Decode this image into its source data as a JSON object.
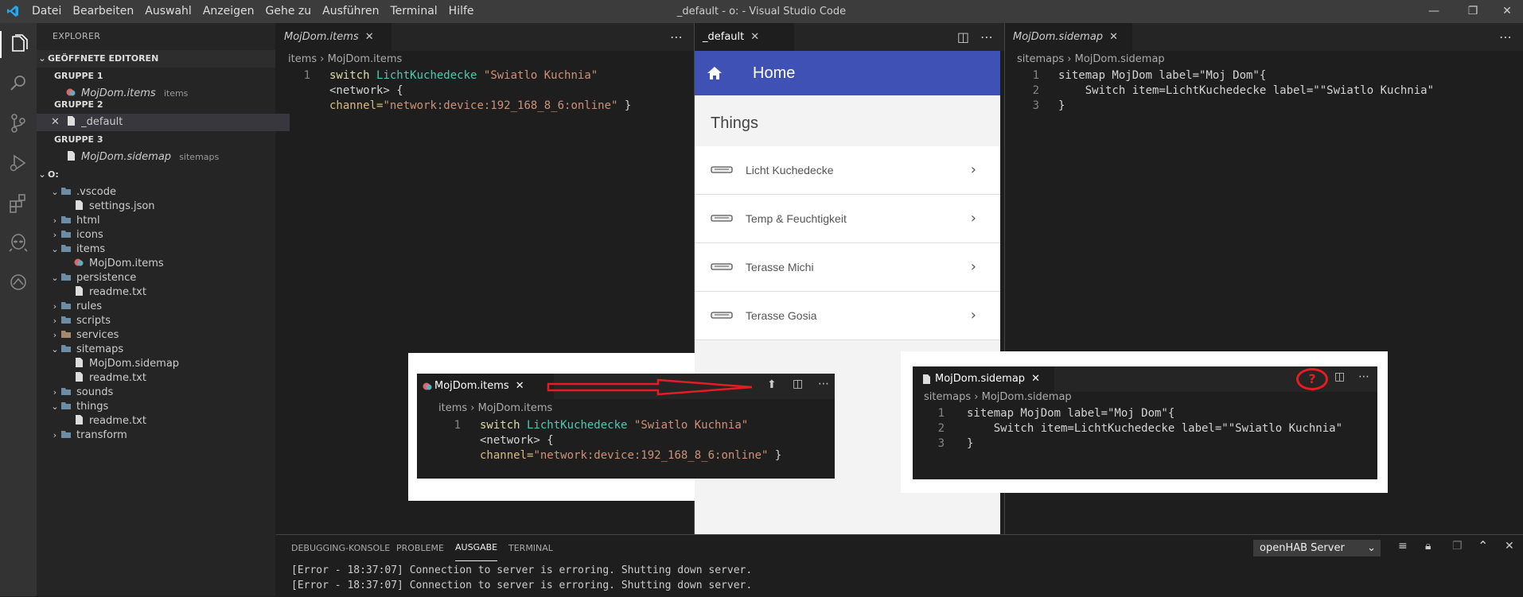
{
  "window": {
    "title": "_default - o: - Visual Studio Code",
    "menu": [
      "Datei",
      "Bearbeiten",
      "Auswahl",
      "Anzeigen",
      "Gehe zu",
      "Ausführen",
      "Terminal",
      "Hilfe"
    ]
  },
  "sidebar": {
    "header": "EXPLORER",
    "open_editors_label": "GEÖFFNETE EDITOREN",
    "groups": [
      {
        "label": "GRUPPE 1",
        "file": "MojDom.items",
        "desc": "items"
      },
      {
        "label": "GRUPPE 2",
        "file": "_default",
        "desc": ""
      },
      {
        "label": "GRUPPE 3",
        "file": "MojDom.sidemap",
        "desc": "sitemaps"
      }
    ],
    "root_label": "O:",
    "tree": [
      {
        "label": ".vscode"
      },
      {
        "label": "settings.json"
      },
      {
        "label": "html"
      },
      {
        "label": "icons"
      },
      {
        "label": "items"
      },
      {
        "label": "MojDom.items"
      },
      {
        "label": "persistence"
      },
      {
        "label": "readme.txt"
      },
      {
        "label": "rules"
      },
      {
        "label": "scripts"
      },
      {
        "label": "services"
      },
      {
        "label": "sitemaps"
      },
      {
        "label": "MojDom.sidemap"
      },
      {
        "label": "readme.txt"
      },
      {
        "label": "sounds"
      },
      {
        "label": "things"
      },
      {
        "label": "readme.txt"
      },
      {
        "label": "transform"
      }
    ]
  },
  "editor1": {
    "tab": "MojDom.items",
    "crumb_folder": "items",
    "crumb_file": "MojDom.items",
    "line_numbers": [
      "1"
    ],
    "code": {
      "kw": "switch",
      "name": "LichtKuchedecke",
      "str": "\"Swiatlo Kuchnia\"",
      "l2": "<network> {",
      "l3a": "channel=",
      "l3b": "\"network:device:192_168_8_6:online\"",
      "l3c": " }"
    }
  },
  "editor2": {
    "tab": "_default",
    "preview": {
      "header": "Home",
      "section": "Things",
      "items": [
        "Licht Kuchedecke",
        "Temp & Feuchtigkeit",
        "Terasse Michi",
        "Terasse Gosia"
      ]
    }
  },
  "editor3": {
    "tab": "MojDom.sidemap",
    "crumb_folder": "sitemaps",
    "crumb_file": "MojDom.sidemap",
    "line_numbers": [
      "1",
      "2",
      "3"
    ],
    "lines": [
      "sitemap MojDom label=\"Moj Dom\"{",
      "    Switch item=LichtKuchedecke label=\"\"Swiatlo Kuchnia\"",
      "}"
    ]
  },
  "overlay1": {
    "tab": "MojDom.items",
    "crumb_folder": "items",
    "crumb_file": "MojDom.items",
    "line_numbers": [
      "1"
    ]
  },
  "overlay2": {
    "tab": "MojDom.sidemap",
    "crumb_folder": "sitemaps",
    "crumb_file": "MojDom.sidemap",
    "line_numbers": [
      "1",
      "2",
      "3"
    ],
    "lines": [
      "sitemap MojDom label=\"Moj Dom\"{",
      "    Switch item=LichtKuchedecke label=\"\"Swiatlo Kuchnia\"",
      "}"
    ],
    "question_mark": "?"
  },
  "panel": {
    "tabs": [
      "DEBUGGING-KONSOLE",
      "PROBLEME",
      "AUSGABE",
      "TERMINAL"
    ],
    "active_tab": "AUSGABE",
    "output_channel": "openHAB Server",
    "lines": [
      "[Error - 18:37:07] Connection to server is erroring. Shutting down server.",
      "[Error - 18:37:07] Connection to server is erroring. Shutting down server."
    ]
  },
  "colors": {
    "accent": "#3f51b5",
    "annotation": "#e51c23"
  }
}
